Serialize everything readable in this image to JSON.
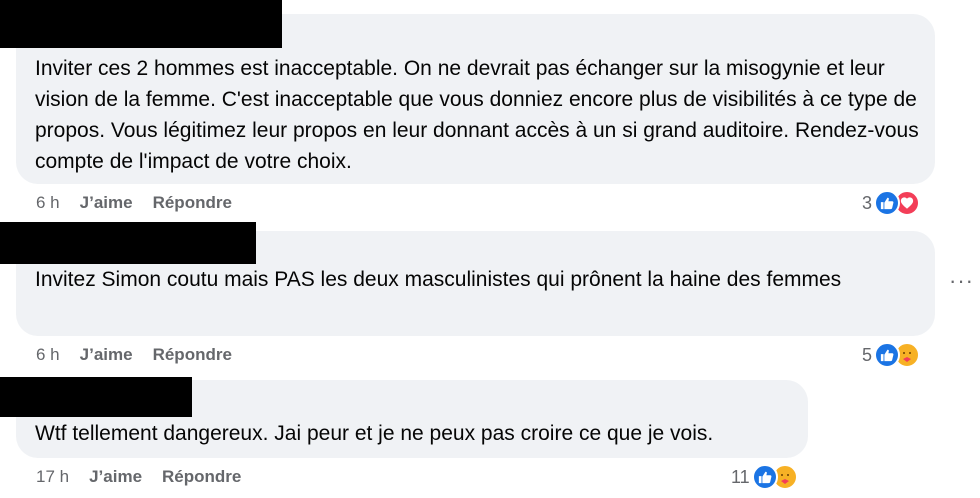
{
  "comments": [
    {
      "text": "Inviter ces 2 hommes est inacceptable. On ne devrait pas échanger sur la misogynie et leur vision de la femme. C'est inacceptable que vous donniez encore plus de visibilités à ce type de propos. Vous légitimez leur propos en leur donnant accès à un si grand auditoire. Rendez-vous compte de l'impact de votre choix.",
      "age": "6 h",
      "like_label": "J’aime",
      "reply_label": "Répondre",
      "reaction_count": "3",
      "reactions": [
        "like-icon",
        "love-icon"
      ]
    },
    {
      "text": "Invitez Simon coutu mais PAS les deux masculinistes qui prônent la haine des femmes",
      "age": "6 h",
      "like_label": "J’aime",
      "reply_label": "Répondre",
      "reaction_count": "5",
      "reactions": [
        "like-icon",
        "care-icon"
      ]
    },
    {
      "text": "Wtf tellement dangereux. Jai peur et je ne peux pas croire ce que je vois.",
      "age": "17 h",
      "like_label": "J’aime",
      "reply_label": "Répondre",
      "reaction_count": "11",
      "reactions": [
        "like-icon",
        "care-icon"
      ]
    }
  ],
  "more_options_glyph": "···",
  "colors": {
    "bubble": "#f0f2f5",
    "meta_text": "#65676b",
    "like_blue": "#1b74e4",
    "love_red": "#f33e58",
    "care_yellow": "#f7b125"
  }
}
